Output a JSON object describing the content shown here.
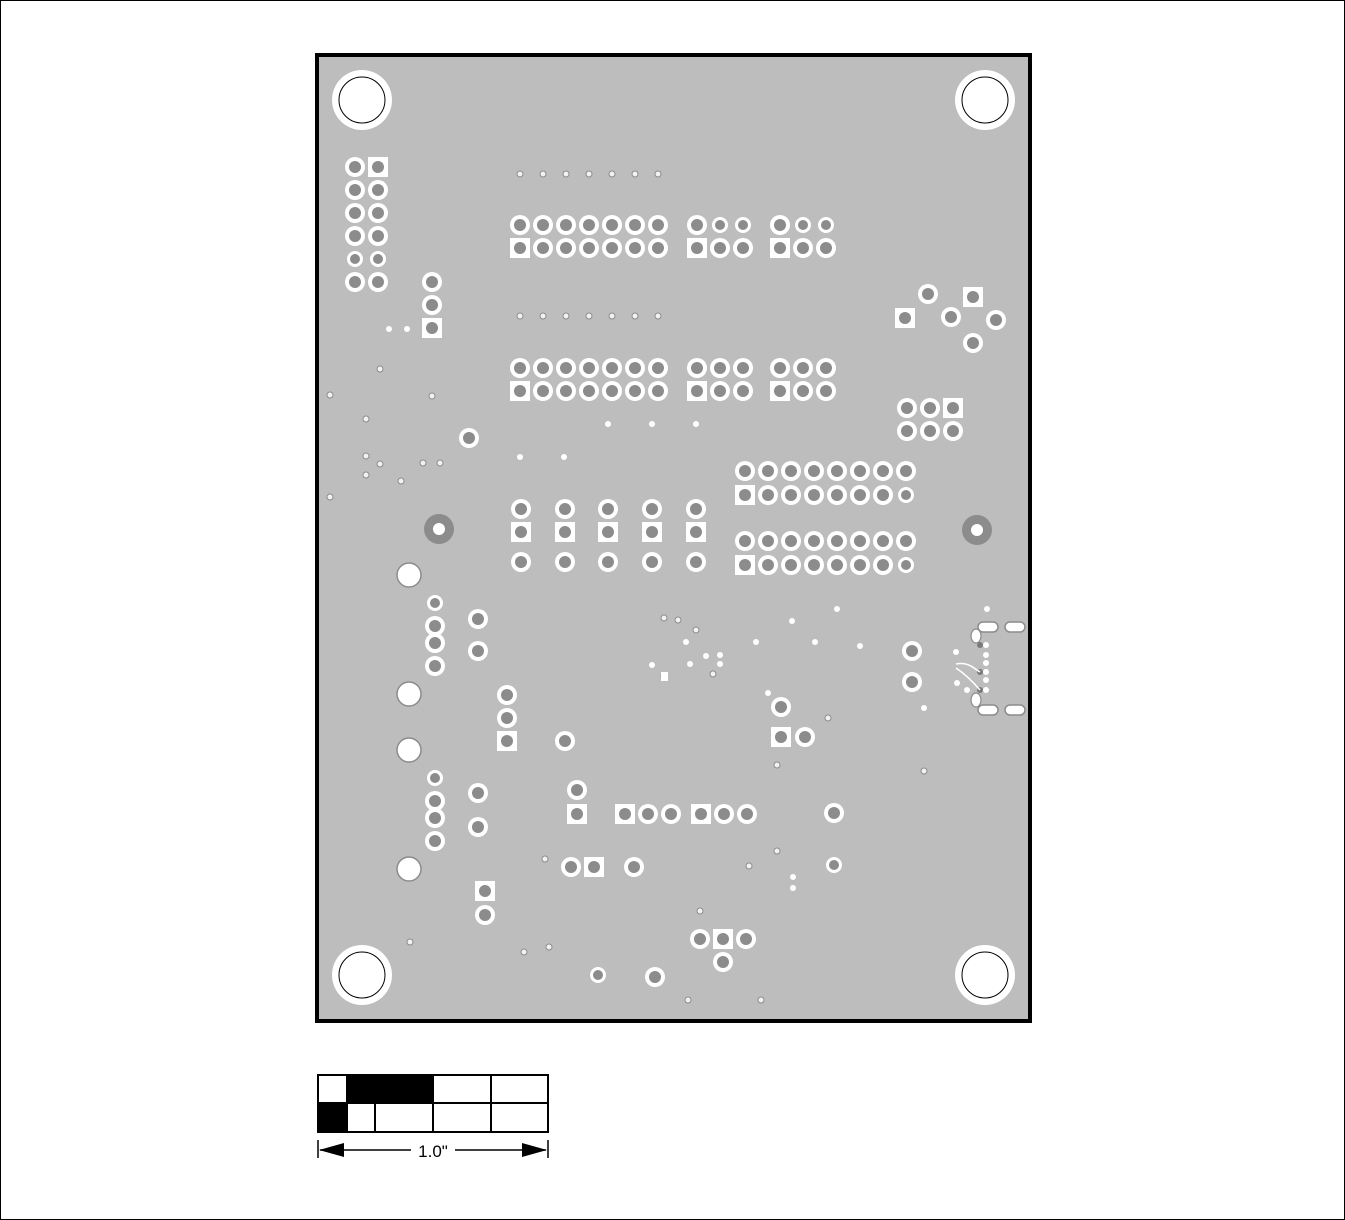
{
  "board": {
    "fill_color": "#bdbdbd",
    "outline_color": "#000000",
    "pad_ring_color": "#ffffff",
    "pad_hole_color": "#8c8c8c"
  },
  "scale_bar": {
    "label": "1.0\""
  }
}
